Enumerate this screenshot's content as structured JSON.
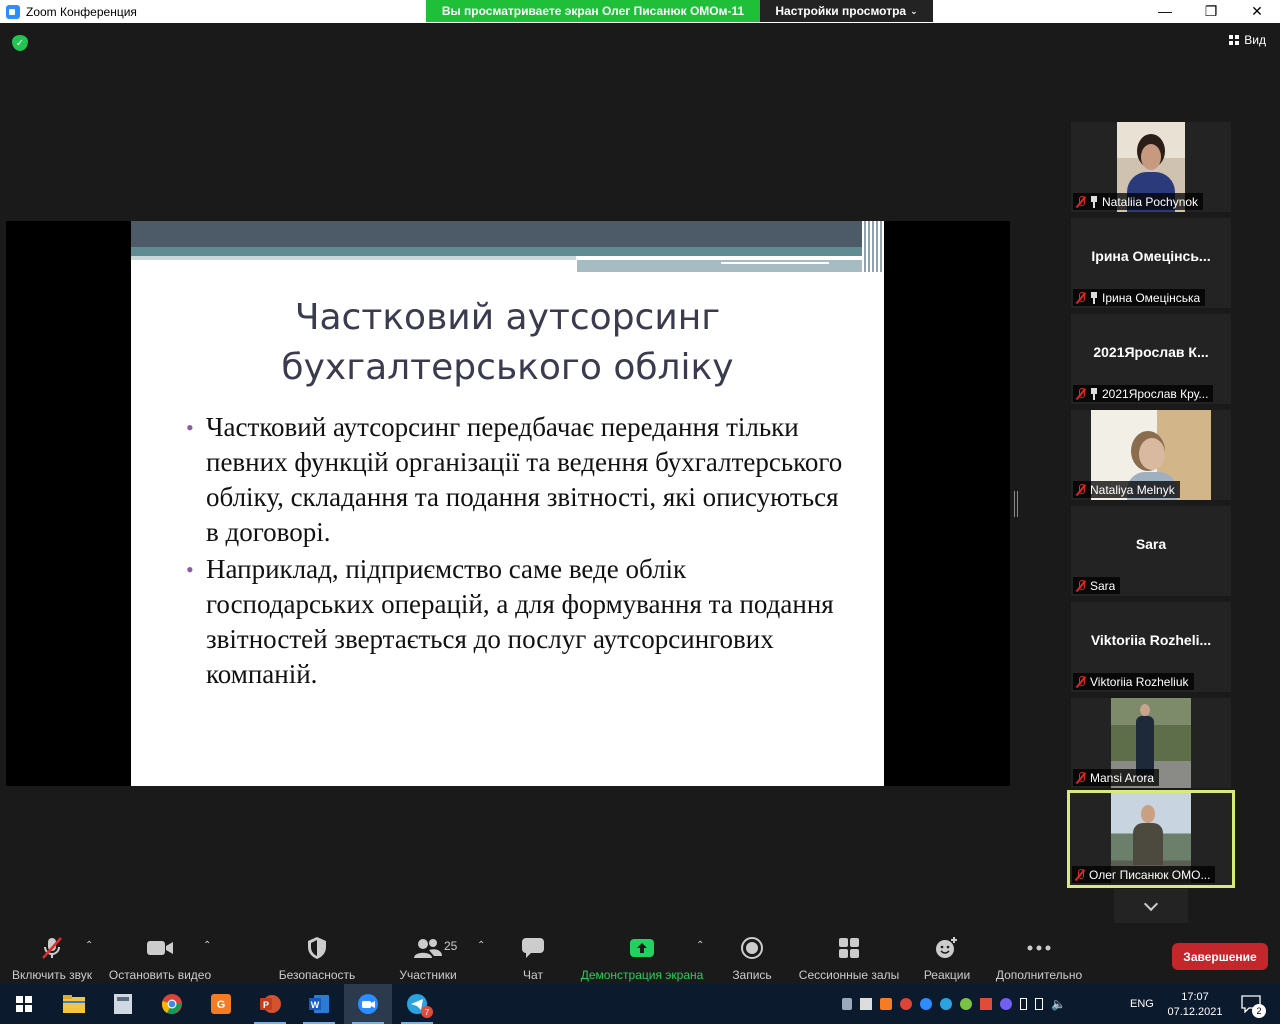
{
  "window": {
    "app_title": "Zoom Конференция",
    "share_banner": "Вы просматриваете экран Олег Писанюк ОМОм-11",
    "view_options": "Настройки просмотра",
    "minimize": "—",
    "maximize": "❐",
    "close": "✕"
  },
  "meeting": {
    "view_label": "Вид"
  },
  "slide": {
    "title_line1": "Частковий аутсорсинг",
    "title_line2": "бухгалтерського обліку",
    "bullets": [
      "Частковий аутсорсинг передбачає передання тільки певних функцій організації та ведення бухгалтерського обліку, складання та подання звітності, які описуються в договорі.",
      "Наприклад, підприємство саме веде облік господарських операцій, а для формування та подання звітностей звертається до послуг аутсорсингових компаній."
    ]
  },
  "participants": [
    {
      "name": "Nataliia Pochynok",
      "big_name": "",
      "video": true,
      "pinned": true
    },
    {
      "name": "Ірина Омецінська",
      "big_name": "Ірина  Омецінсь...",
      "video": false,
      "pinned": true
    },
    {
      "name": "2021Ярослав Кру...",
      "big_name": "2021Ярослав  К...",
      "video": false,
      "pinned": true
    },
    {
      "name": "Nataliya Melnyk",
      "big_name": "",
      "video": true,
      "pinned": false
    },
    {
      "name": "Sara",
      "big_name": "Sara",
      "video": false,
      "pinned": false
    },
    {
      "name": "Viktoriia Rozheliuk",
      "big_name": "Viktoriia  Rozheli...",
      "video": false,
      "pinned": false
    },
    {
      "name": "Mansi Arora",
      "big_name": "",
      "video": true,
      "pinned": false
    },
    {
      "name": "Олег Писанюк ОМО...",
      "big_name": "",
      "video": true,
      "pinned": false,
      "active": true
    }
  ],
  "toolbar": {
    "unmute": "Включить звук",
    "stop_video": "Остановить видео",
    "security": "Безопасность",
    "participants": "Участники",
    "participants_count": "25",
    "chat": "Чат",
    "share_screen": "Демонстрация экрана",
    "record": "Запись",
    "breakout": "Сессионные залы",
    "reactions": "Реакции",
    "more": "Дополнительно",
    "end": "Завершение"
  },
  "taskbar": {
    "language": "ENG",
    "time": "17:07",
    "date": "07.12.2021",
    "notifications": "2",
    "telegram_badge": "7"
  },
  "colors": {
    "accent_green": "#23d160",
    "end_red": "#c3272b",
    "active_border": "#d8ea7a",
    "bullet_purple": "#8e5aa6"
  }
}
